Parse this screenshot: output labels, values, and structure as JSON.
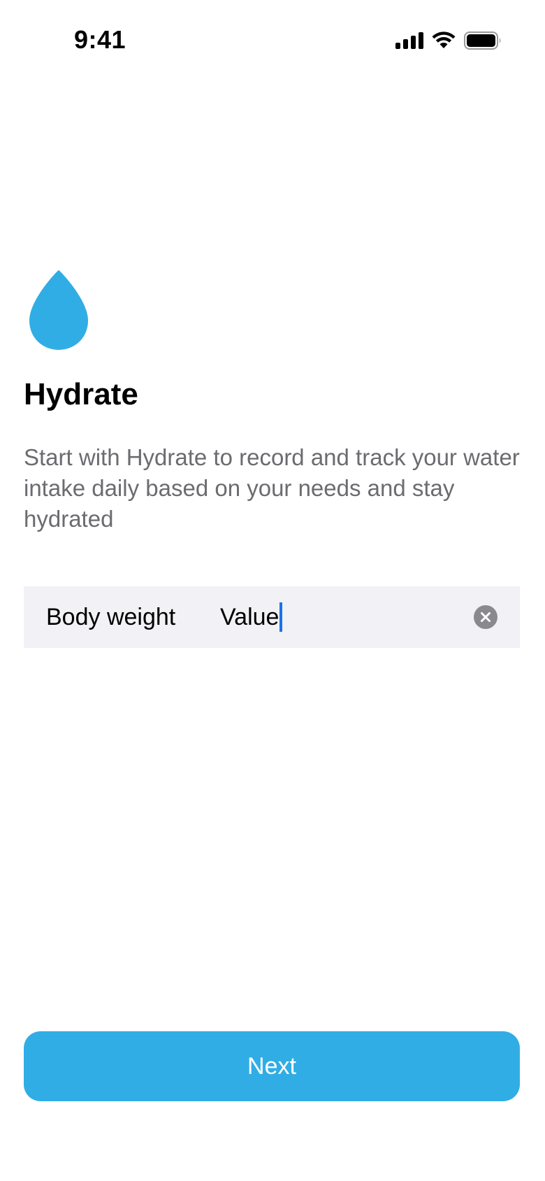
{
  "status_bar": {
    "time": "9:41",
    "icons": [
      "cellular-signal-icon",
      "wifi-icon",
      "battery-icon"
    ]
  },
  "app": {
    "icon": "water-drop-icon",
    "title": "Hydrate",
    "description": "Start with Hydrate to record and track your water intake daily based on your needs and stay hydrated"
  },
  "form": {
    "body_weight_label": "Body weight",
    "body_weight_value": "Value",
    "clear_icon": "clear-icon"
  },
  "footer": {
    "next_label": "Next"
  },
  "colors": {
    "accent": "#31ADE5",
    "field_background": "#F1F1F6",
    "secondary_text": "#6B6B70",
    "caret": "#1A73E8",
    "clear_button": "#8A8A8E"
  }
}
